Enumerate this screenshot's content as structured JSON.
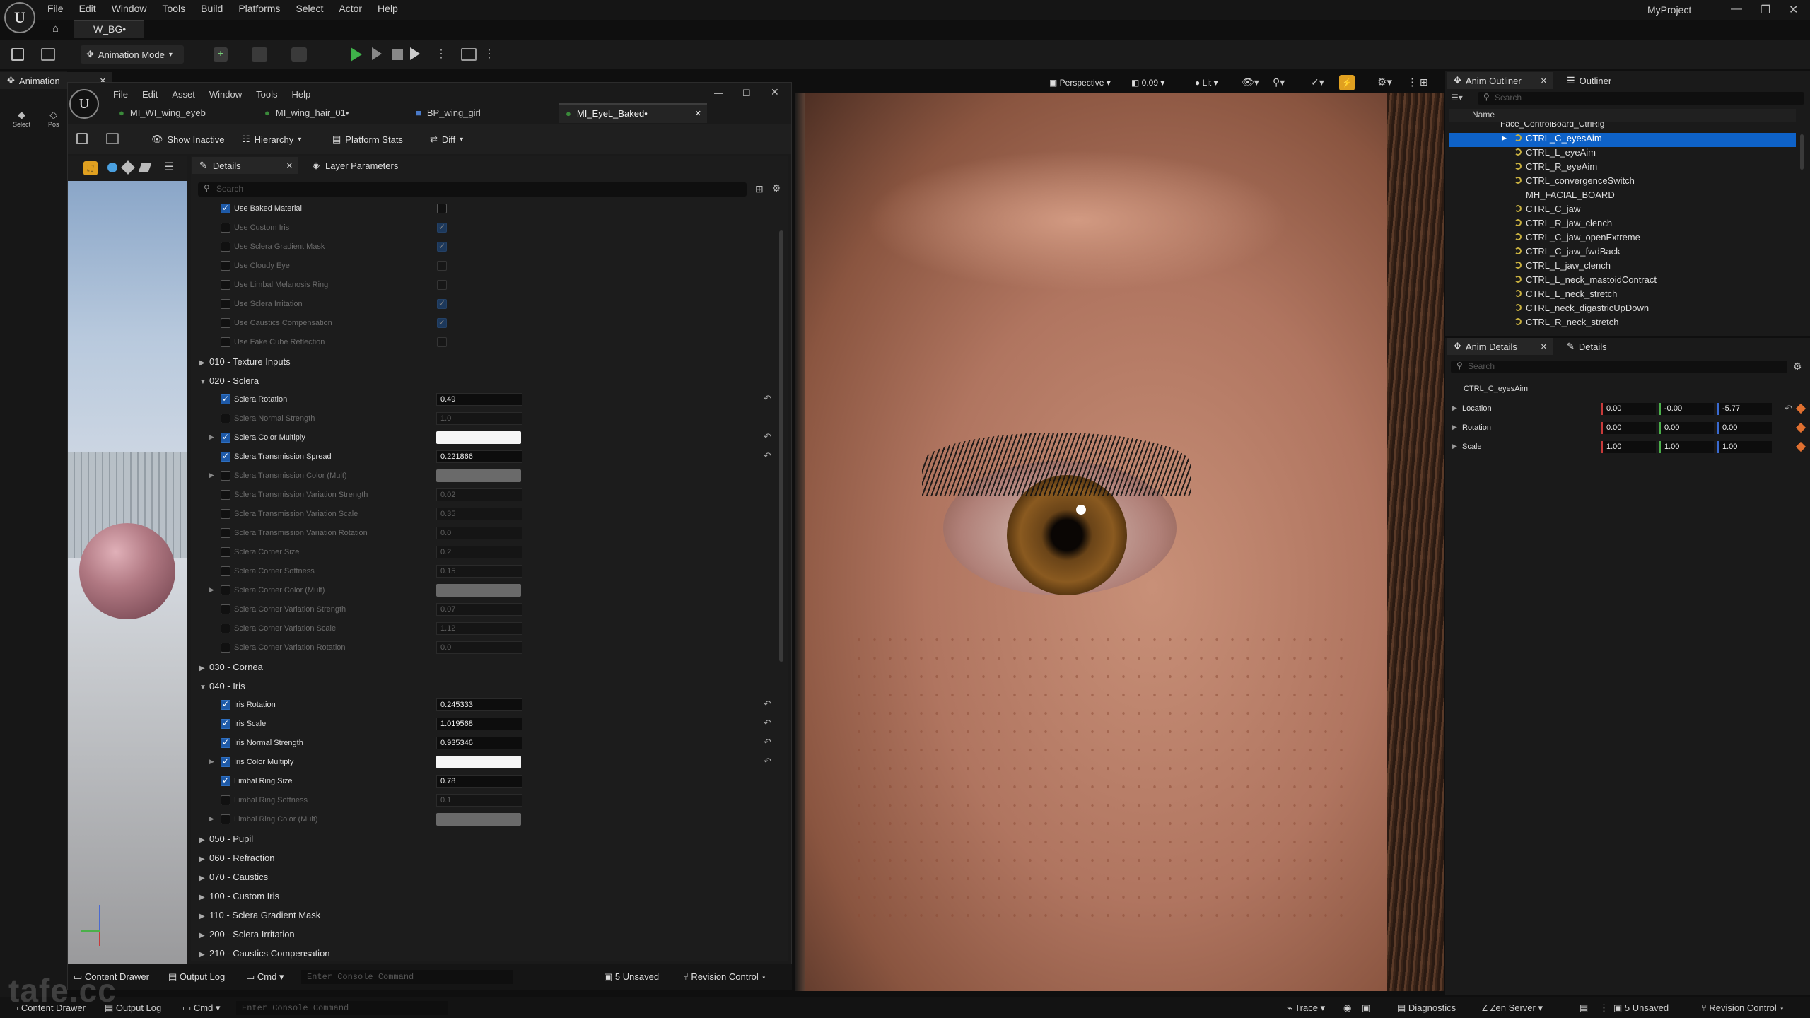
{
  "app": {
    "project": "MyProject",
    "doc_tab": "W_BG•"
  },
  "menu": [
    "File",
    "Edit",
    "Window",
    "Tools",
    "Build",
    "Platforms",
    "Select",
    "Actor",
    "Help"
  ],
  "toolbar": {
    "mode": "Animation Mode"
  },
  "left_panel": {
    "title": "Animation",
    "tools": [
      "Select",
      "Pos"
    ]
  },
  "material_editor": {
    "menu": [
      "File",
      "Edit",
      "Asset",
      "Window",
      "Tools",
      "Help"
    ],
    "tabs": [
      "MI_WI_wing_eyeb",
      "MI_wing_hair_01•",
      "BP_wing_girl",
      "MI_EyeL_Baked•"
    ],
    "toolbar": [
      "Show Inactive",
      "Hierarchy",
      "Platform Stats",
      "Diff"
    ],
    "details_tab": "Details",
    "layer_tab": "Layer Parameters",
    "search_placeholder": "Search"
  },
  "params_top": [
    {
      "label": "Use Baked Material",
      "checked": true,
      "value_checked": false,
      "dim": false
    },
    {
      "label": "Use Custom Iris",
      "checked": false,
      "value_checked": true,
      "dim": true
    },
    {
      "label": "Use Sclera Gradient Mask",
      "checked": false,
      "value_checked": true,
      "dim": true
    },
    {
      "label": "Use Cloudy Eye",
      "checked": false,
      "value_checked": false,
      "dim": true
    },
    {
      "label": "Use Limbal Melanosis Ring",
      "checked": false,
      "value_checked": false,
      "dim": true
    },
    {
      "label": "Use Sclera Irritation",
      "checked": false,
      "value_checked": true,
      "dim": true
    },
    {
      "label": "Use Caustics Compensation",
      "checked": false,
      "value_checked": true,
      "dim": true
    },
    {
      "label": "Use Fake Cube Reflection",
      "checked": false,
      "value_checked": false,
      "dim": true
    }
  ],
  "cat_texture": "010 - Texture Inputs",
  "cat_sclera": "020 - Sclera",
  "sclera_params": [
    {
      "label": "Sclera Rotation",
      "value": "0.49",
      "checked": true,
      "reset": true
    },
    {
      "label": "Sclera Normal Strength",
      "value": "1.0",
      "checked": false
    },
    {
      "label": "Sclera Color Multiply",
      "color": "#f6f6f6",
      "checked": true,
      "reset": true,
      "expand": true
    },
    {
      "label": "Sclera Transmission Spread",
      "value": "0.221866",
      "checked": true,
      "reset": true
    },
    {
      "label": "Sclera Transmission Color (Mult)",
      "color": "#6a6a6a",
      "checked": false,
      "expand": true
    },
    {
      "label": "Sclera Transmission Variation Strength",
      "value": "0.02",
      "checked": false
    },
    {
      "label": "Sclera Transmission Variation Scale",
      "value": "0.35",
      "checked": false
    },
    {
      "label": "Sclera Transmission Variation Rotation",
      "value": "0.0",
      "checked": false
    },
    {
      "label": "Sclera Corner Size",
      "value": "0.2",
      "checked": false
    },
    {
      "label": "Sclera Corner Softness",
      "value": "0.15",
      "checked": false
    },
    {
      "label": "Sclera Corner Color (Mult)",
      "color": "#6a6a6a",
      "checked": false,
      "expand": true
    },
    {
      "label": "Sclera Corner Variation Strength",
      "value": "0.07",
      "checked": false
    },
    {
      "label": "Sclera Corner Variation Scale",
      "value": "1.12",
      "checked": false
    },
    {
      "label": "Sclera Corner Variation Rotation",
      "value": "0.0",
      "checked": false
    }
  ],
  "cat_cornea": "030 - Cornea",
  "cat_iris": "040 - Iris",
  "iris_params": [
    {
      "label": "Iris Rotation",
      "value": "0.245333",
      "checked": true,
      "reset": true
    },
    {
      "label": "Iris Scale",
      "value": "1.019568",
      "checked": true,
      "reset": true
    },
    {
      "label": "Iris Normal Strength",
      "value": "0.935346",
      "checked": true,
      "reset": true
    },
    {
      "label": "Iris Color Multiply",
      "color": "#f6f6f6",
      "checked": true,
      "reset": true,
      "expand": true
    },
    {
      "label": "Limbal Ring Size",
      "value": "0.78",
      "checked": true
    },
    {
      "label": "Limbal Ring Softness",
      "value": "0.1",
      "checked": false
    },
    {
      "label": "Limbal Ring Color (Mult)",
      "color": "#6a6a6a",
      "checked": false,
      "expand": true
    }
  ],
  "cats_bottom": [
    "050 - Pupil",
    "060 - Refraction",
    "070 - Caustics",
    "100 - Custom Iris",
    "110 - Sclera Gradient Mask",
    "200 - Sclera Irritation",
    "210 - Caustics Compensation"
  ],
  "mat_bottom": {
    "content_drawer": "Content Drawer",
    "output_log": "Output Log",
    "cmd": "Cmd",
    "console_placeholder": "Enter Console Command",
    "unsaved": "5 Unsaved",
    "revision": "Revision Control"
  },
  "viewport": {
    "perspective": "Perspective",
    "fov": "0.09",
    "lit": "Lit"
  },
  "outliner": {
    "tab1": "Anim Outliner",
    "tab2": "Outliner",
    "search_placeholder": "Search",
    "col_name": "Name",
    "partial_row": "Face_ControlBoard_CtrlRig",
    "rows": [
      "CTRL_C_eyesAim",
      "CTRL_L_eyeAim",
      "CTRL_R_eyeAim",
      "CTRL_convergenceSwitch",
      "MH_FACIAL_BOARD",
      "CTRL_C_jaw",
      "CTRL_R_jaw_clench",
      "CTRL_C_jaw_openExtreme",
      "CTRL_C_jaw_fwdBack",
      "CTRL_L_jaw_clench",
      "CTRL_L_neck_mastoidContract",
      "CTRL_L_neck_stretch",
      "CTRL_neck_digastricUpDown",
      "CTRL_R_neck_stretch"
    ]
  },
  "anim_details": {
    "tab1": "Anim Details",
    "tab2": "Details",
    "search_placeholder": "Search",
    "control": "CTRL_C_eyesAim",
    "rows": [
      {
        "label": "Location",
        "x": "0.00",
        "y": "-0.00",
        "z": "-5.77"
      },
      {
        "label": "Rotation",
        "x": "0.00",
        "y": "0.00",
        "z": "0.00"
      },
      {
        "label": "Scale",
        "x": "1.00",
        "y": "1.00",
        "z": "1.00"
      }
    ]
  },
  "statusbar": {
    "content_drawer": "Content Drawer",
    "output_log": "Output Log",
    "cmd": "Cmd",
    "console_placeholder": "Enter Console Command",
    "trace": "Trace",
    "diagnostics": "Diagnostics",
    "zen": "Zen Server",
    "unsaved": "5 Unsaved",
    "revision": "Revision Control"
  },
  "watermark": "tafe.cc"
}
